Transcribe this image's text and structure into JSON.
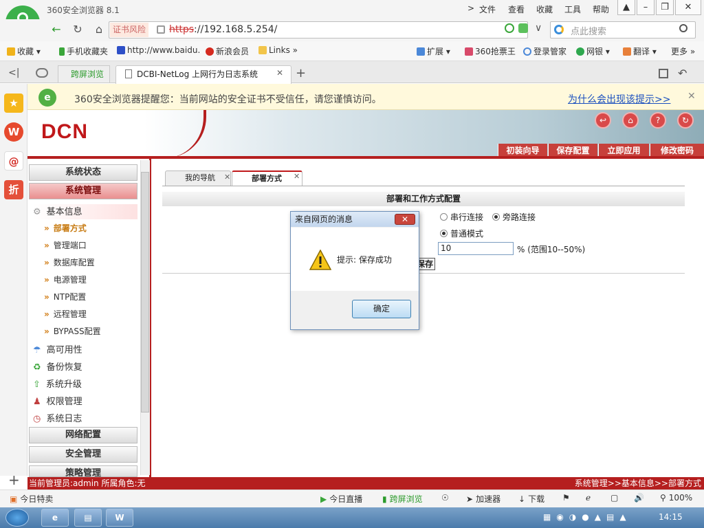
{
  "browser": {
    "app_title": "360安全浏览器 8.1",
    "menu": [
      "文件",
      "查看",
      "收藏",
      "工具",
      "帮助"
    ],
    "cert_warning": "证书风险",
    "url_scheme": "https",
    "url_rest": "://192.168.5.254/",
    "search_placeholder": "点此搜索",
    "bookmarks": [
      "收藏",
      "手机收藏夹",
      "http://www.baidu.",
      "新浪会员",
      "Links"
    ],
    "bookmarks_right": [
      "扩展",
      "360抢票王",
      "登录管家",
      "网银",
      "翻译",
      "更多"
    ],
    "tab_split": "跨屏浏览",
    "tab_active": "DCBI-NetLog 上网行为日志系统",
    "warning_text": "360安全浏览器提醒您：当前网站的安全证书不受信任，请您谨慎访问。",
    "warning_link": "为什么会出现该提示>>",
    "bottom_left": "今日特卖",
    "bottom_right": [
      "今日直播",
      "跨屏浏览",
      "加速器",
      "下载",
      "100%"
    ],
    "clock": "14:15"
  },
  "app": {
    "logo": "DCN",
    "top_buttons": [
      "初装向导",
      "保存配置",
      "立即应用",
      "修改密码"
    ],
    "nav": {
      "sections": [
        "系统状态",
        "系统管理"
      ],
      "group_basic": "基本信息",
      "sub_items": [
        "部署方式",
        "管理端口",
        "数据库配置",
        "电源管理",
        "NTP配置",
        "远程管理",
        "BYPASS配置"
      ],
      "groups": [
        "高可用性",
        "备份恢复",
        "系统升级",
        "权限管理",
        "系统日志"
      ],
      "sections_bottom": [
        "网络配置",
        "安全管理",
        "策略管理"
      ]
    },
    "content_tabs": [
      "我的导航",
      "部署方式"
    ],
    "section_title": "部署和工作方式配置",
    "mode_serial": "串行连接",
    "mode_bypass": "旁路连接",
    "work_mode": "普通模式",
    "ratio_value": "10",
    "ratio_hint": "% (范围10--50%)",
    "save_button": "保存",
    "status_left": "当前管理员:admin   所属角色:无",
    "status_right": "系统管理>>基本信息>>部署方式"
  },
  "dialog": {
    "title": "来自网页的消息",
    "message": "提示: 保存成功",
    "ok": "确定"
  }
}
